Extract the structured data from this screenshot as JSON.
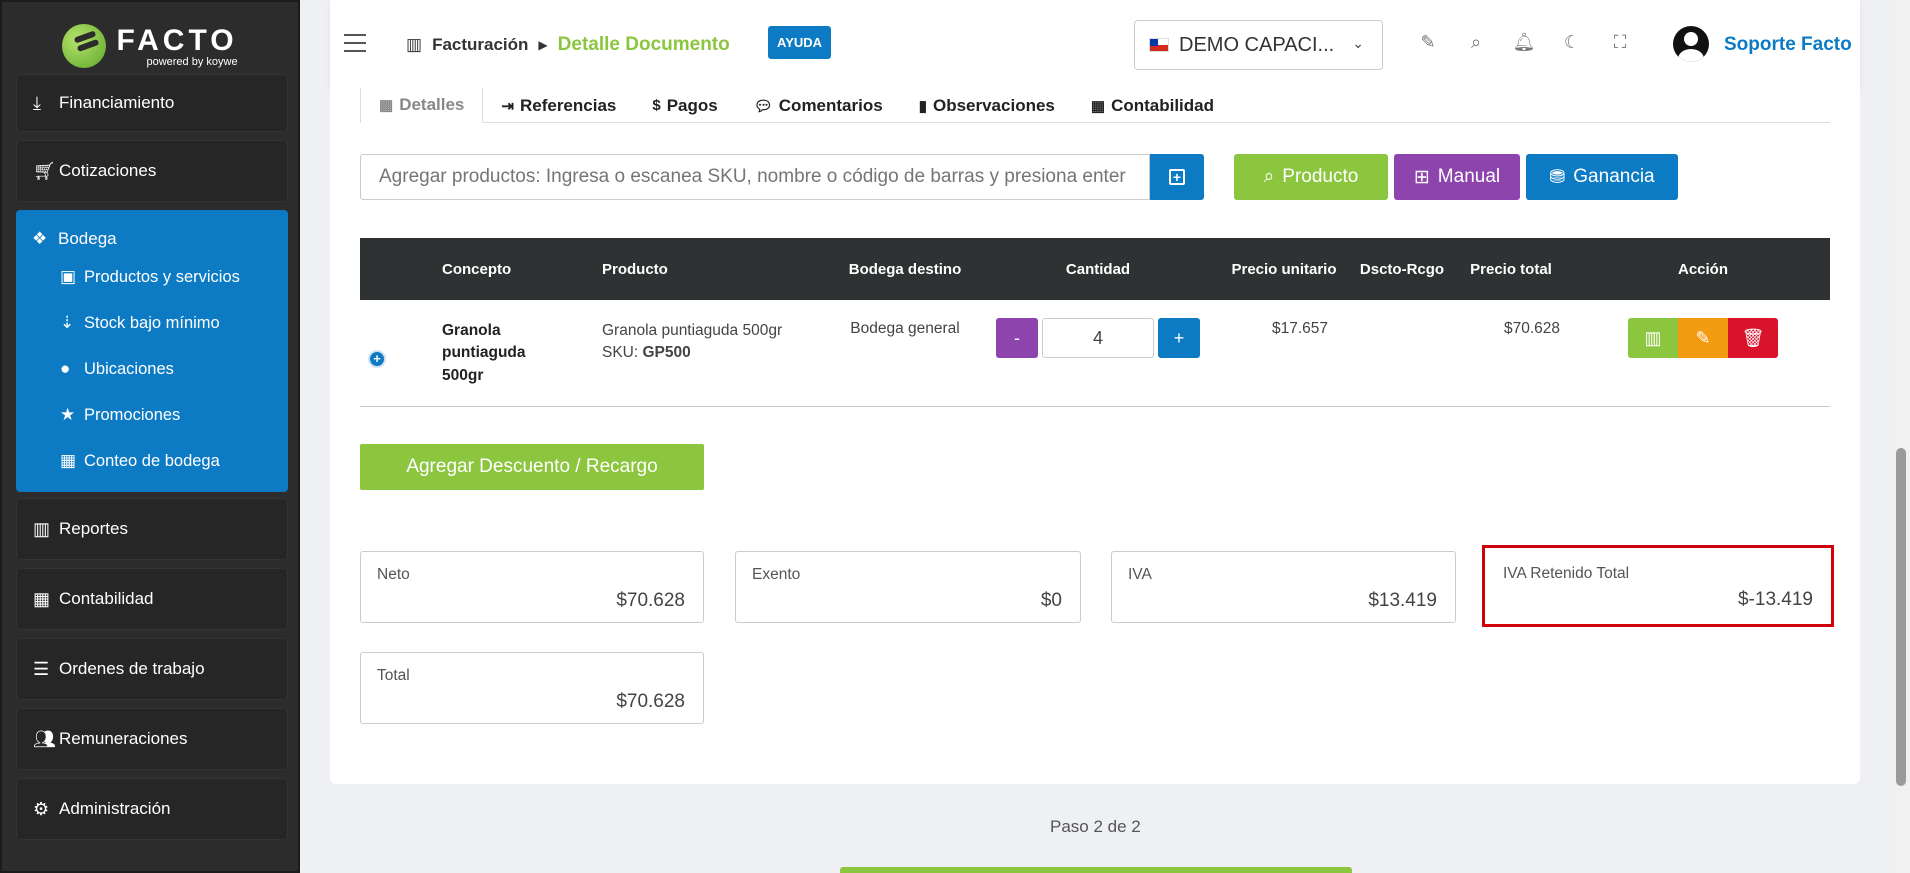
{
  "sidebar": {
    "logo": {
      "brand": "FACTO",
      "powered": "powered by koywe"
    },
    "items_top": [
      {
        "label": "Financiamiento",
        "icon": "hand-money-icon"
      },
      {
        "label": "Cotizaciones",
        "icon": "cart-icon"
      }
    ],
    "active_group": {
      "label": "Bodega",
      "icon": "cubes-icon",
      "children": [
        {
          "label": "Productos y servicios",
          "icon": "box-icon"
        },
        {
          "label": "Stock bajo mínimo",
          "icon": "sort-down-icon"
        },
        {
          "label": "Ubicaciones",
          "icon": "map-marker-icon"
        },
        {
          "label": "Promociones",
          "icon": "star-icon"
        },
        {
          "label": "Conteo de bodega",
          "icon": "calculator-icon"
        }
      ]
    },
    "items_bottom": [
      {
        "label": "Reportes",
        "icon": "bar-chart-icon"
      },
      {
        "label": "Contabilidad",
        "icon": "calculator-icon"
      },
      {
        "label": "Ordenes de trabajo",
        "icon": "tasks-icon"
      },
      {
        "label": "Remuneraciones",
        "icon": "users-icon"
      },
      {
        "label": "Administración",
        "icon": "gears-icon"
      }
    ]
  },
  "header": {
    "breadcrumb_1": "Facturación",
    "breadcrumb_2": "Detalle Documento",
    "help_label": "AYUDA",
    "company": "DEMO CAPACI...",
    "user_name": "Soporte Facto"
  },
  "tabs": [
    {
      "label": "Detalles",
      "icon": "table-icon",
      "active": true
    },
    {
      "label": "Referencias",
      "icon": "file-import-icon"
    },
    {
      "label": "Pagos",
      "icon": "dollar-icon"
    },
    {
      "label": "Comentarios",
      "icon": "comments-icon"
    },
    {
      "label": "Observaciones",
      "icon": "book-icon"
    },
    {
      "label": "Contabilidad",
      "icon": "calculator-icon"
    }
  ],
  "add_products": {
    "placeholder": "Agregar productos: Ingresa o escanea SKU, nombre o código de barras y presiona enter",
    "btn_producto": "Producto",
    "btn_manual": "Manual",
    "btn_ganancia": "Ganancia"
  },
  "table": {
    "headers": [
      "Concepto",
      "Producto",
      "Bodega destino",
      "Cantidad",
      "Precio unitario",
      "Dscto-Rcgo",
      "Precio total",
      "Acción"
    ],
    "row": {
      "concepto": "Granola puntiaguda 500gr",
      "producto": "Granola puntiaguda 500gr",
      "sku_label": "SKU:",
      "sku": "GP500",
      "bodega": "Bodega general",
      "cantidad": "4",
      "minus": "-",
      "plus": "+",
      "precio_unitario": "$17.657",
      "dscto": "",
      "precio_total": "$70.628"
    }
  },
  "discount_button": "Agregar Descuento / Recargo",
  "totals": {
    "neto": {
      "label": "Neto",
      "value": "$70.628"
    },
    "exento": {
      "label": "Exento",
      "value": "$0"
    },
    "iva": {
      "label": "IVA",
      "value": "$13.419"
    },
    "iva_ret": {
      "label": "IVA Retenido Total",
      "value": "$-13.419"
    },
    "total": {
      "label": "Total",
      "value": "$70.628"
    }
  },
  "step": "Paso 2 de 2",
  "colors": {
    "primary": "#0d7ac4",
    "green": "#8cc63f",
    "purple": "#8e44ad",
    "orange": "#f39c12",
    "red": "#d9132c",
    "highlight": "#d0020b"
  }
}
